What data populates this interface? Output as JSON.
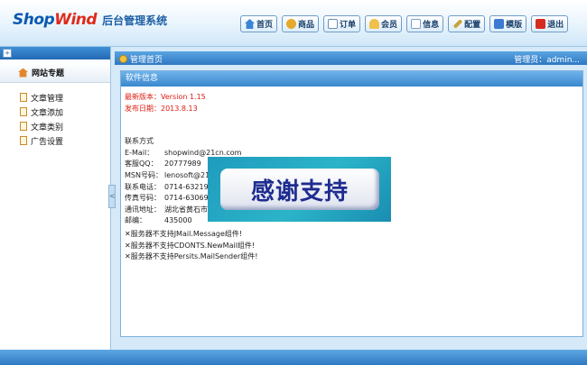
{
  "header": {
    "logo_shop": "Shop",
    "logo_wind": "Wind",
    "logo_sub": "后台管理系统",
    "buttons": [
      {
        "label": "首页",
        "icon": "home-icon"
      },
      {
        "label": "商品",
        "icon": "goods-icon"
      },
      {
        "label": "订单",
        "icon": "order-icon"
      },
      {
        "label": "会员",
        "icon": "member-icon"
      },
      {
        "label": "信息",
        "icon": "info-icon"
      },
      {
        "label": "配置",
        "icon": "config-icon"
      },
      {
        "label": "模版",
        "icon": "template-icon"
      },
      {
        "label": "退出",
        "icon": "logout-icon"
      }
    ]
  },
  "sidebar": {
    "toggle": "+",
    "section": "网站专题",
    "items": [
      {
        "label": "文章管理"
      },
      {
        "label": "文章添加"
      },
      {
        "label": "文章类别"
      },
      {
        "label": "广告设置"
      }
    ],
    "split_handle": "<"
  },
  "content": {
    "breadcrumb": "管理首页",
    "admin": "管理员：admin..."
  },
  "panel": {
    "title": "软件信息",
    "version": "最新版本：Version 1.15",
    "release": "发布日期：2013.8.13",
    "contact_title": "联系方式",
    "contacts": [
      {
        "k": "E-Mail：",
        "v": "shopwind@21cn.com"
      },
      {
        "k": "客服QQ：",
        "v": "20777989"
      },
      {
        "k": "MSN号码：",
        "v": "lenosoft@21c"
      },
      {
        "k": "联系电话：",
        "v": "0714-632198"
      },
      {
        "k": "传真号码：",
        "v": "0714-630698"
      },
      {
        "k": "通讯地址：",
        "v": "湖北省黄石市"
      },
      {
        "k": "邮编：",
        "v": "435000"
      }
    ],
    "warnings": [
      "✕服务器不支持JMail.Message组件!",
      "✕服务器不支持CDONTS.NewMail组件!",
      "✕服务器不支持Persits.MailSender组件!"
    ]
  },
  "banner": {
    "text": "感谢支持"
  },
  "colors": {
    "brand_blue": "#0b59b0",
    "brand_red": "#e0291a",
    "bar_blue": "#2e78c3"
  }
}
